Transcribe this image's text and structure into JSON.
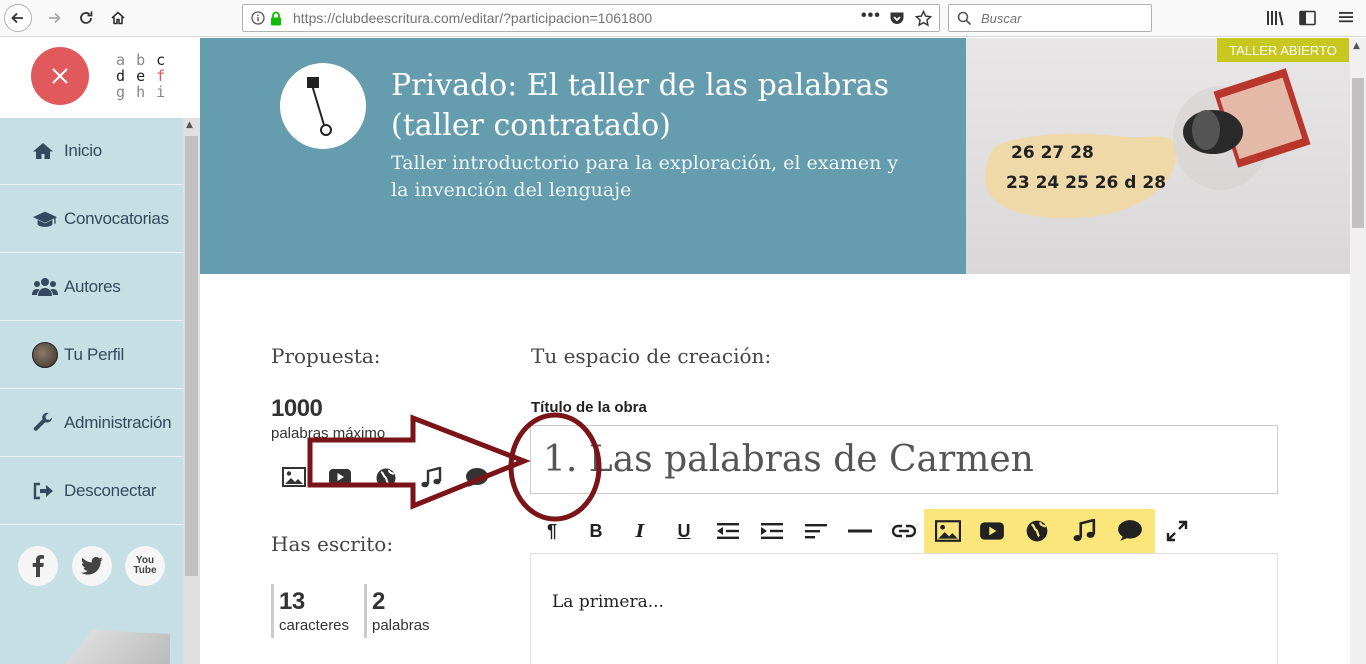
{
  "browser": {
    "url": "https://clubdeescritura.com/editar/?participacion=1061800",
    "search_placeholder": "Buscar"
  },
  "sidebar": {
    "logo_rows": [
      [
        "a",
        "b",
        "c"
      ],
      [
        "d",
        "e",
        "f"
      ],
      [
        "g",
        "h",
        "i"
      ]
    ],
    "items": [
      {
        "label": "Inicio",
        "icon": "home-icon"
      },
      {
        "label": "Convocatorias",
        "icon": "graduation-cap-icon"
      },
      {
        "label": "Autores",
        "icon": "users-icon"
      },
      {
        "label": "Tu Perfil",
        "icon": "avatar"
      },
      {
        "label": "Administración",
        "icon": "wrench-icon"
      },
      {
        "label": "Desconectar",
        "icon": "sign-out-icon"
      }
    ],
    "social": [
      "facebook-icon",
      "twitter-icon",
      "youtube-icon"
    ],
    "youtube_text": "You Tube"
  },
  "header": {
    "title": "Privado: El taller de las palabras (taller contratado)",
    "subtitle": "Taller introductorio para la exploración, el examen y la invención del lenguaje",
    "badge": "TALLER ABIERTO",
    "photo_numbers_row1": "26 27 28",
    "photo_numbers_row2": "23 24 25 26 d 28",
    "accent_color": "#659daf",
    "badge_color": "#c8c71f"
  },
  "proposal": {
    "heading": "Propuesta:",
    "max_words": "1000",
    "max_words_label": "palabras máximo",
    "media_icons": [
      "image-icon",
      "video-icon",
      "globe-icon",
      "music-icon",
      "comment-icon"
    ]
  },
  "written": {
    "heading": "Has escrito:",
    "chars": "13",
    "chars_label": "caracteres",
    "words": "2",
    "words_label": "palabras"
  },
  "editor": {
    "heading": "Tu espacio de creación:",
    "title_label": "Título de la obra",
    "title_value": "1. Las palabras de Carmen",
    "toolbar": [
      "paragraph-icon",
      "bold-icon",
      "italic-icon",
      "underline-icon",
      "outdent-icon",
      "indent-icon",
      "align-left-icon",
      "horizontal-rule-icon",
      "link-icon",
      "image-icon",
      "video-icon",
      "globe-icon",
      "music-icon",
      "comment-icon",
      "fullscreen-icon"
    ],
    "body_text": "La primera..."
  }
}
